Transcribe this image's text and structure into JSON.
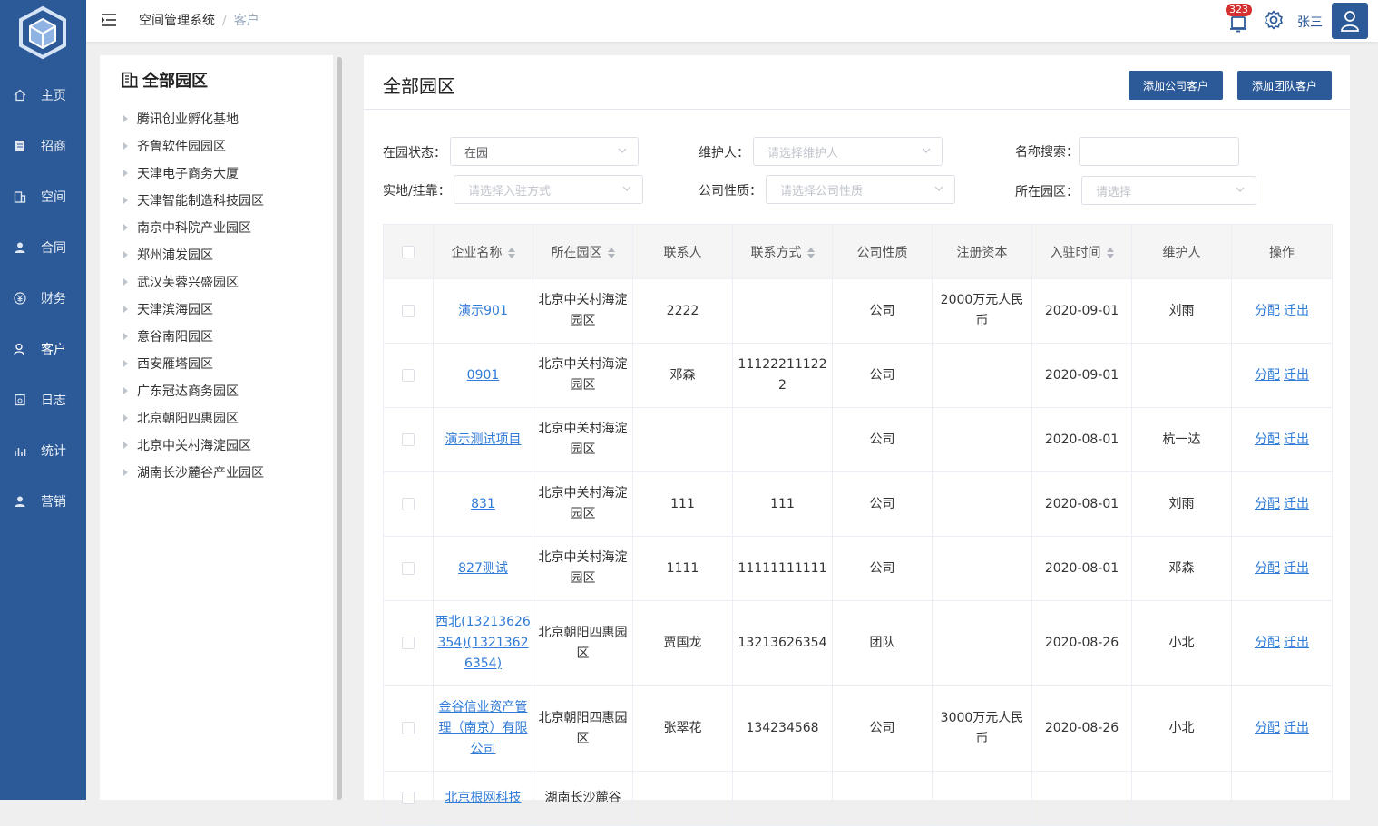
{
  "nav": {
    "items": [
      {
        "label": "主页",
        "icon": "home-icon"
      },
      {
        "label": "招商",
        "icon": "document-icon"
      },
      {
        "label": "空间",
        "icon": "building-icon"
      },
      {
        "label": "合同",
        "icon": "user-icon"
      },
      {
        "label": "财务",
        "icon": "yen-icon"
      },
      {
        "label": "客户",
        "icon": "person-icon"
      },
      {
        "label": "日志",
        "icon": "log-icon"
      },
      {
        "label": "统计",
        "icon": "chart-icon"
      },
      {
        "label": "营销",
        "icon": "user-icon"
      }
    ],
    "active_index": 5
  },
  "header": {
    "breadcrumb_root": "空间管理系统",
    "breadcrumb_sep": "/",
    "breadcrumb_current": "客户",
    "notification_count": "323",
    "user_name": "张三"
  },
  "tree": {
    "title": "全部园区",
    "items": [
      "腾讯创业孵化基地",
      "齐鲁软件园园区",
      "天津电子商务大厦",
      "天津智能制造科技园区",
      "南京中科院产业园区",
      "郑州浦发园区",
      "武汉芙蓉兴盛园区",
      "天津滨海园区",
      "意谷南阳园区",
      "西安雁塔园区",
      "广东冠达商务园区",
      "北京朝阳四惠园区",
      "北京中关村海淀园区",
      "湖南长沙麓谷产业园区"
    ]
  },
  "main": {
    "title": "全部园区",
    "add_company_label": "添加公司客户",
    "add_team_label": "添加团队客户"
  },
  "filters": {
    "status_label": "在园状态：",
    "status_value": "在园",
    "maintainer_label": "维护人：",
    "maintainer_placeholder": "请选择维护人",
    "name_search_label": "名称搜索：",
    "name_search_value": "",
    "entry_label": "实地/挂靠：",
    "entry_placeholder": "请选择入驻方式",
    "nature_label": "公司性质：",
    "nature_placeholder": "请选择公司性质",
    "park_label": "所在园区：",
    "park_placeholder": "请选择"
  },
  "table": {
    "headers": [
      "企业名称",
      "所在园区",
      "联系人",
      "联系方式",
      "公司性质",
      "注册资本",
      "入驻时间",
      "维护人",
      "操作"
    ],
    "action_assign": "分配",
    "action_move": "迁出",
    "rows": [
      {
        "name": "演示901",
        "park": "北京中关村海淀园区",
        "contact": "2222",
        "phone": "",
        "nature": "公司",
        "capital": "2000万元人民币",
        "date": "2020-09-01",
        "maintainer": "刘雨"
      },
      {
        "name": "0901",
        "park": "北京中关村海淀园区",
        "contact": "邓森",
        "phone": "111222111222",
        "nature": "公司",
        "capital": "",
        "date": "2020-09-01",
        "maintainer": ""
      },
      {
        "name": "演示测试项目",
        "park": "北京中关村海淀园区",
        "contact": "",
        "phone": "",
        "nature": "公司",
        "capital": "",
        "date": "2020-08-01",
        "maintainer": "杭一达"
      },
      {
        "name": "831",
        "park": "北京中关村海淀园区",
        "contact": "111",
        "phone": "111",
        "nature": "公司",
        "capital": "",
        "date": "2020-08-01",
        "maintainer": "刘雨"
      },
      {
        "name": "827测试",
        "park": "北京中关村海淀园区",
        "contact": "1111",
        "phone": "11111111111",
        "nature": "公司",
        "capital": "",
        "date": "2020-08-01",
        "maintainer": "邓森"
      },
      {
        "name": "西北(13213626354)(13213626354)",
        "park": "北京朝阳四惠园区",
        "contact": "贾国龙",
        "phone": "13213626354",
        "nature": "团队",
        "capital": "",
        "date": "2020-08-26",
        "maintainer": "小北"
      },
      {
        "name": "金谷信业资产管理（南京）有限公司",
        "park": "北京朝阳四惠园区",
        "contact": "张翠花",
        "phone": "134234568",
        "nature": "公司",
        "capital": "3000万元人民币",
        "date": "2020-08-26",
        "maintainer": "小北"
      },
      {
        "name": "北京根网科技",
        "park": "湖南长沙麓谷",
        "contact": "",
        "phone": "",
        "nature": "",
        "capital": "",
        "date": "",
        "maintainer": ""
      }
    ]
  }
}
